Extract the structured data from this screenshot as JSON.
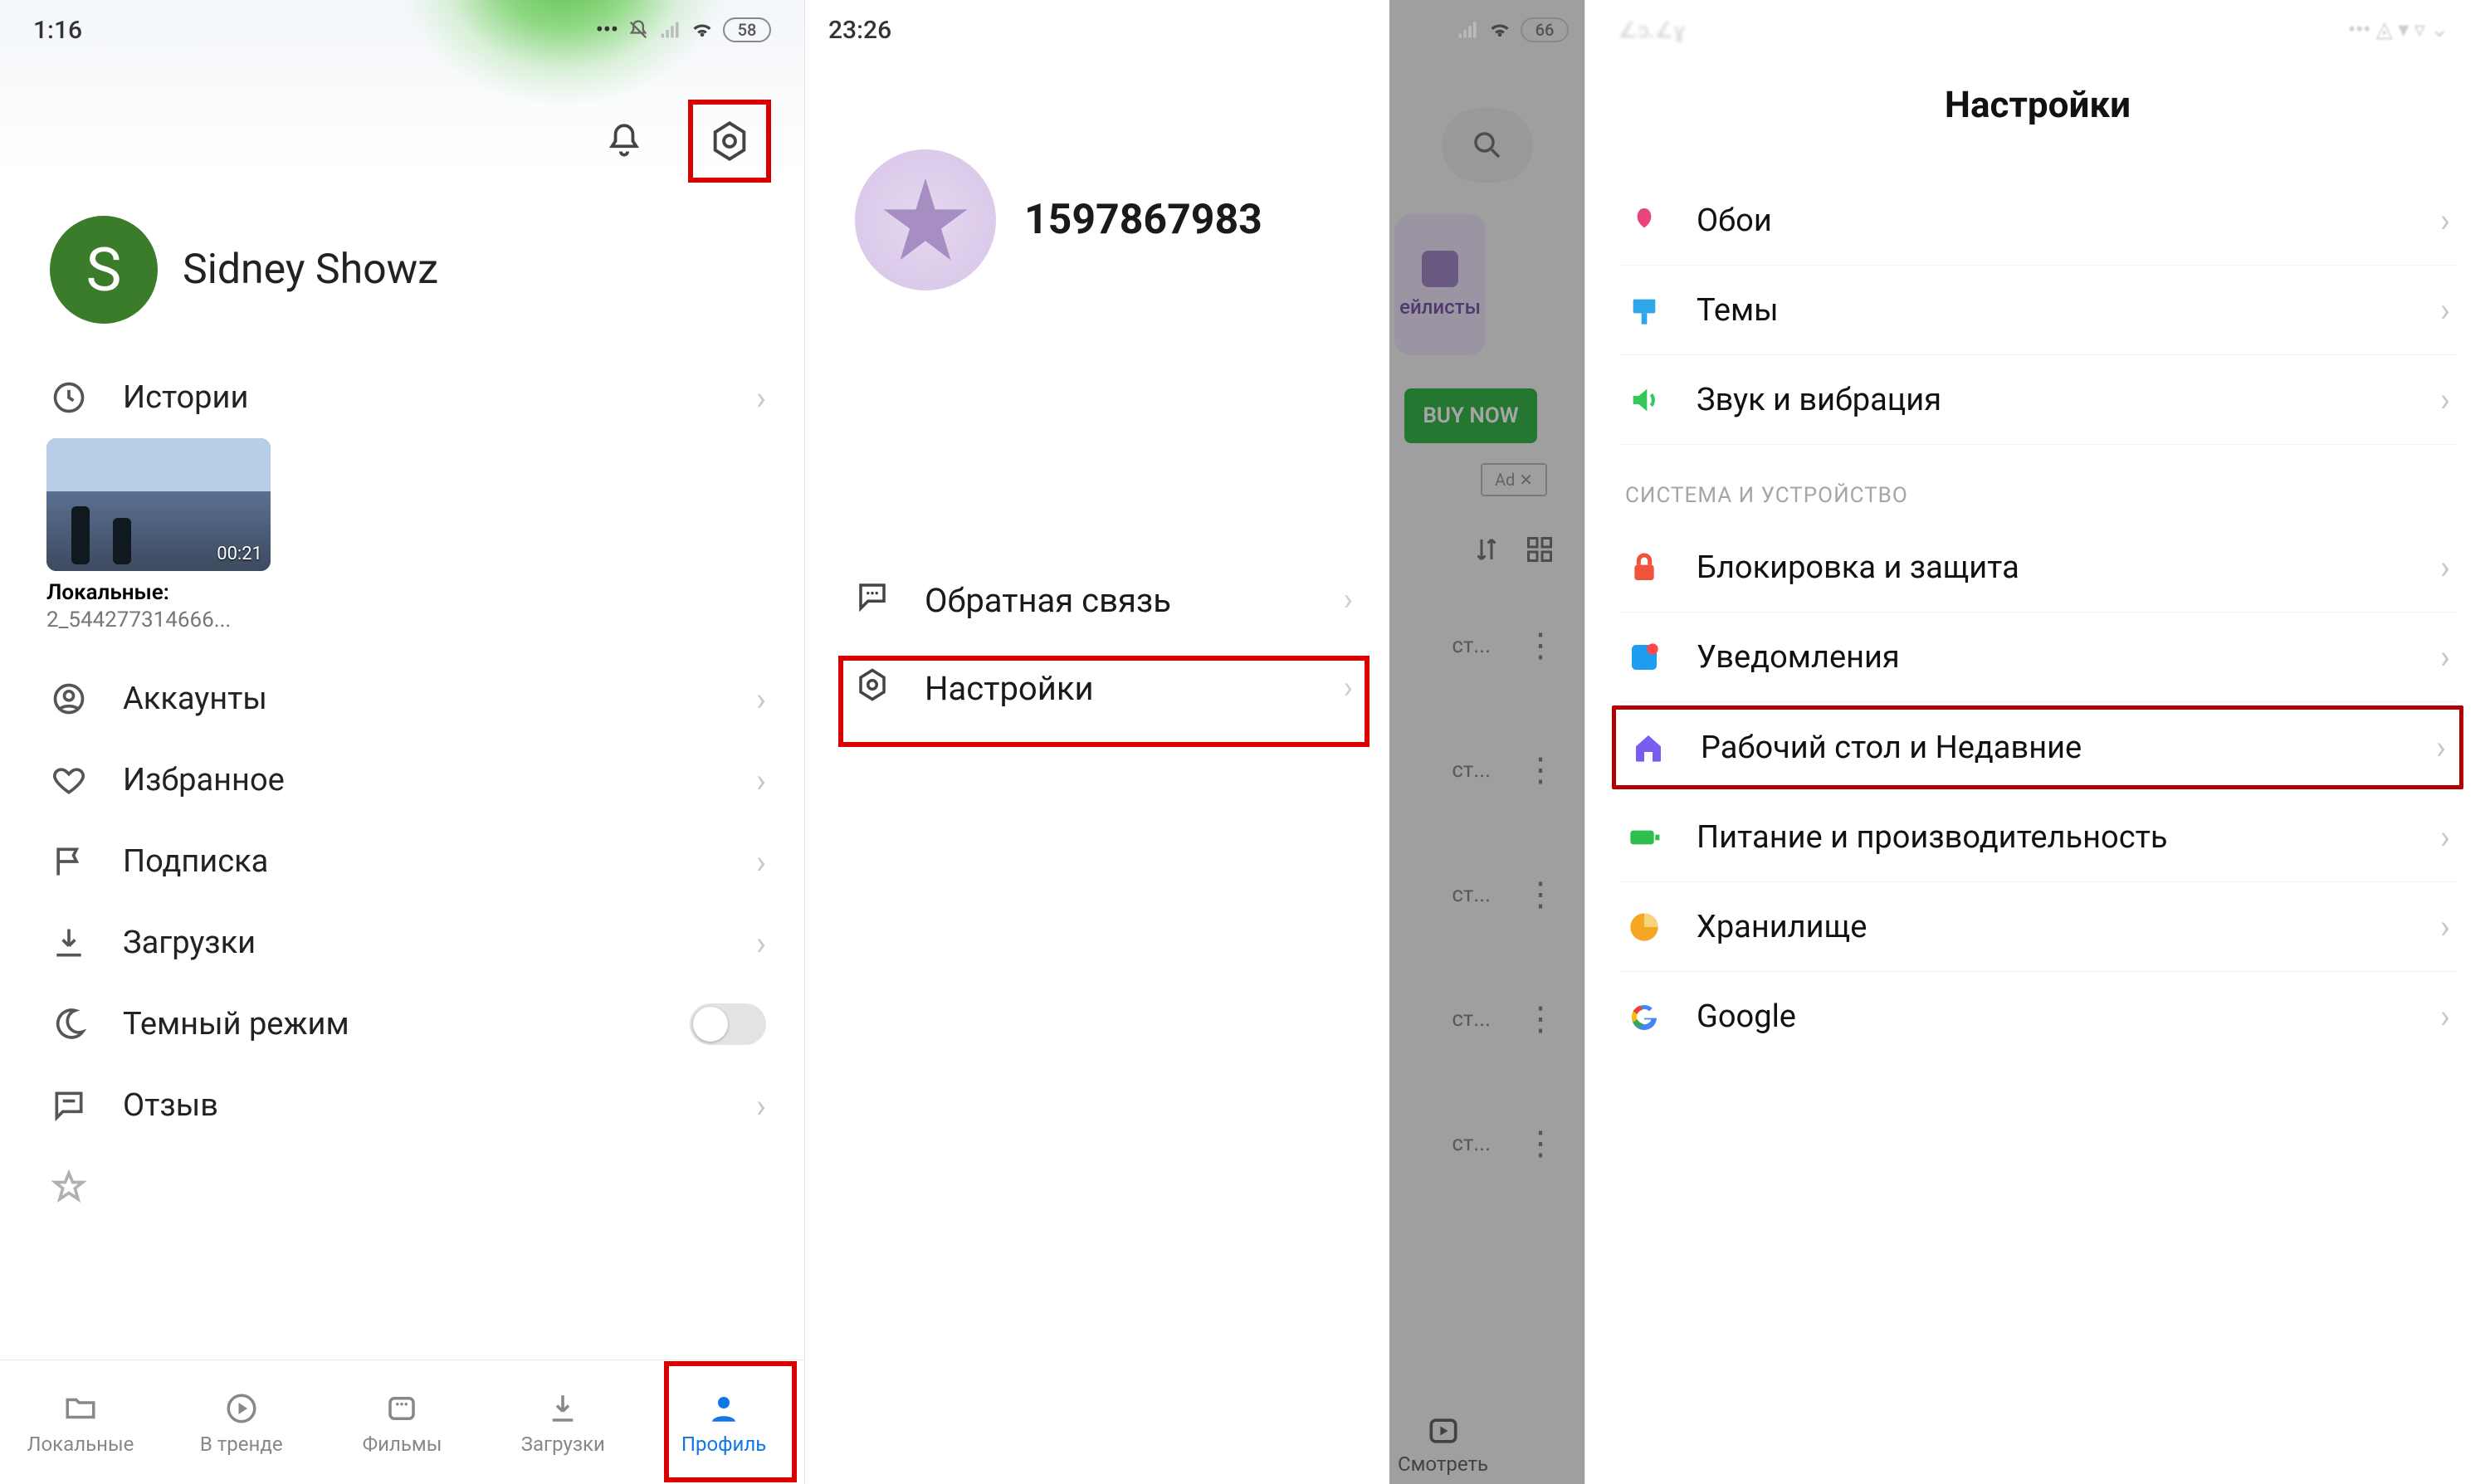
{
  "screen1": {
    "time": "1:16",
    "battery": "58",
    "profile_name": "Sidney Showz",
    "avatar_letter": "S",
    "story": {
      "duration": "00:21",
      "caption_label": "Локальные:",
      "caption_file": "2_544277314666..."
    },
    "menu": {
      "history": "Истории",
      "accounts": "Аккаунты",
      "favorites": "Избранное",
      "subscription": "Подписка",
      "downloads": "Загрузки",
      "dark_mode": "Темный режим",
      "feedback": "Отзыв"
    },
    "nav": {
      "local": "Локальные",
      "trending": "В тренде",
      "movies": "Фильмы",
      "downloads": "Загрузки",
      "profile": "Профиль"
    }
  },
  "screen2": {
    "time": "23:26",
    "battery": "66",
    "user_id": "1597867983",
    "menu": {
      "feedback": "Обратная связь",
      "settings": "Настройки"
    },
    "under": {
      "playlists": "ейлисты",
      "buy": "BUY NOW",
      "ad": "Ad ✕",
      "item_suffix": "ст...",
      "watch": "Смотреть"
    }
  },
  "screen3": {
    "title": "Настройки",
    "section_system": "СИСТЕМА И УСТРОЙСТВО",
    "items": {
      "wallpaper": "Обои",
      "themes": "Темы",
      "sound": "Звук и вибрация",
      "lock": "Блокировка и защита",
      "notifications": "Уведомления",
      "home": "Рабочий стол и Недавние",
      "power": "Питание и производительность",
      "storage": "Хранилище",
      "google": "Google"
    }
  }
}
